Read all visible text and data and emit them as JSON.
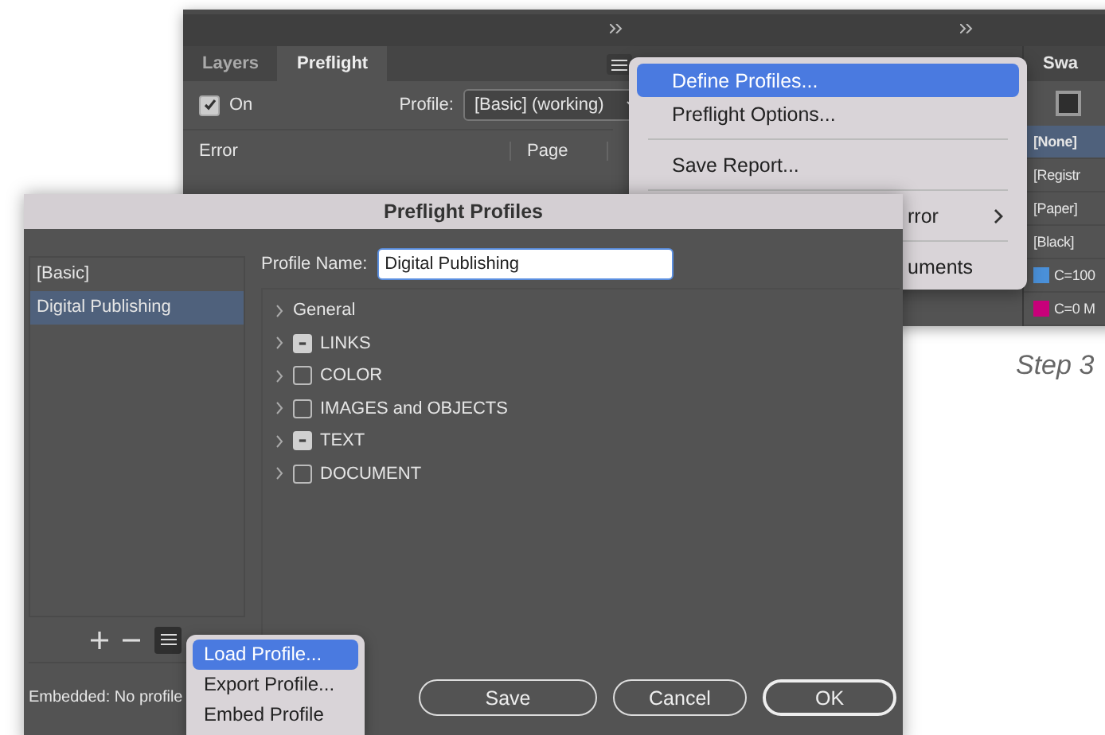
{
  "background_panel": {
    "tabs": [
      {
        "label": "Layers",
        "selected": false
      },
      {
        "label": "Preflight",
        "selected": true
      }
    ],
    "on_checkbox": {
      "label": "On",
      "checked": true
    },
    "profile_label": "Profile:",
    "profile_value": "[Basic] (working)",
    "columns": [
      "Error",
      "Page"
    ],
    "swatches_tab": "Swa",
    "swatches": [
      {
        "name": "[None]",
        "selected": true
      },
      {
        "name": "[Registr",
        "selected": false
      },
      {
        "name": "[Paper]",
        "selected": false
      },
      {
        "name": "[Black]",
        "selected": false
      },
      {
        "name": "C=100",
        "selected": false,
        "color": "#4a90d9"
      },
      {
        "name": "C=0 M",
        "selected": false,
        "color": "#c8007a"
      }
    ]
  },
  "panel_menu": {
    "items": [
      {
        "kind": "item",
        "label": "Define Profiles...",
        "selected": true,
        "submenu": false
      },
      {
        "kind": "item",
        "label": "Preflight Options...",
        "selected": false,
        "submenu": false
      },
      {
        "kind": "separator"
      },
      {
        "kind": "item",
        "label": "Save Report...",
        "selected": false,
        "submenu": false
      },
      {
        "kind": "separator"
      },
      {
        "kind": "item",
        "label": "rror",
        "selected": false,
        "submenu": true
      },
      {
        "kind": "separator"
      },
      {
        "kind": "item",
        "label": "uments",
        "selected": false,
        "submenu": false
      }
    ]
  },
  "dialog": {
    "title": "Preflight Profiles",
    "profiles": [
      {
        "label": "[Basic]",
        "selected": false
      },
      {
        "label": "Digital Publishing",
        "selected": true
      }
    ],
    "profile_name_label": "Profile Name:",
    "profile_name_value": "Digital Publishing",
    "categories": [
      {
        "kind": "group",
        "label": "General",
        "expanded": false
      },
      {
        "kind": "checkbox",
        "label": "LINKS",
        "expanded": false,
        "mixed": true
      },
      {
        "kind": "checkbox",
        "label": "COLOR",
        "expanded": false,
        "mixed": false
      },
      {
        "kind": "checkbox",
        "label": "IMAGES and OBJECTS",
        "expanded": false,
        "mixed": false
      },
      {
        "kind": "checkbox",
        "label": "TEXT",
        "expanded": false,
        "mixed": true
      },
      {
        "kind": "checkbox",
        "label": "DOCUMENT",
        "expanded": false,
        "mixed": false
      }
    ],
    "embedded_status": "Embedded: No profile",
    "buttons": [
      {
        "label": "Save",
        "default": false
      },
      {
        "label": "Cancel",
        "default": false
      },
      {
        "label": "OK",
        "default": true
      }
    ]
  },
  "profile_menu": {
    "items": [
      {
        "label": "Load Profile...",
        "selected": true
      },
      {
        "label": "Export Profile...",
        "selected": false
      },
      {
        "label": "Embed Profile",
        "selected": false
      }
    ]
  },
  "caption": "Step 3"
}
